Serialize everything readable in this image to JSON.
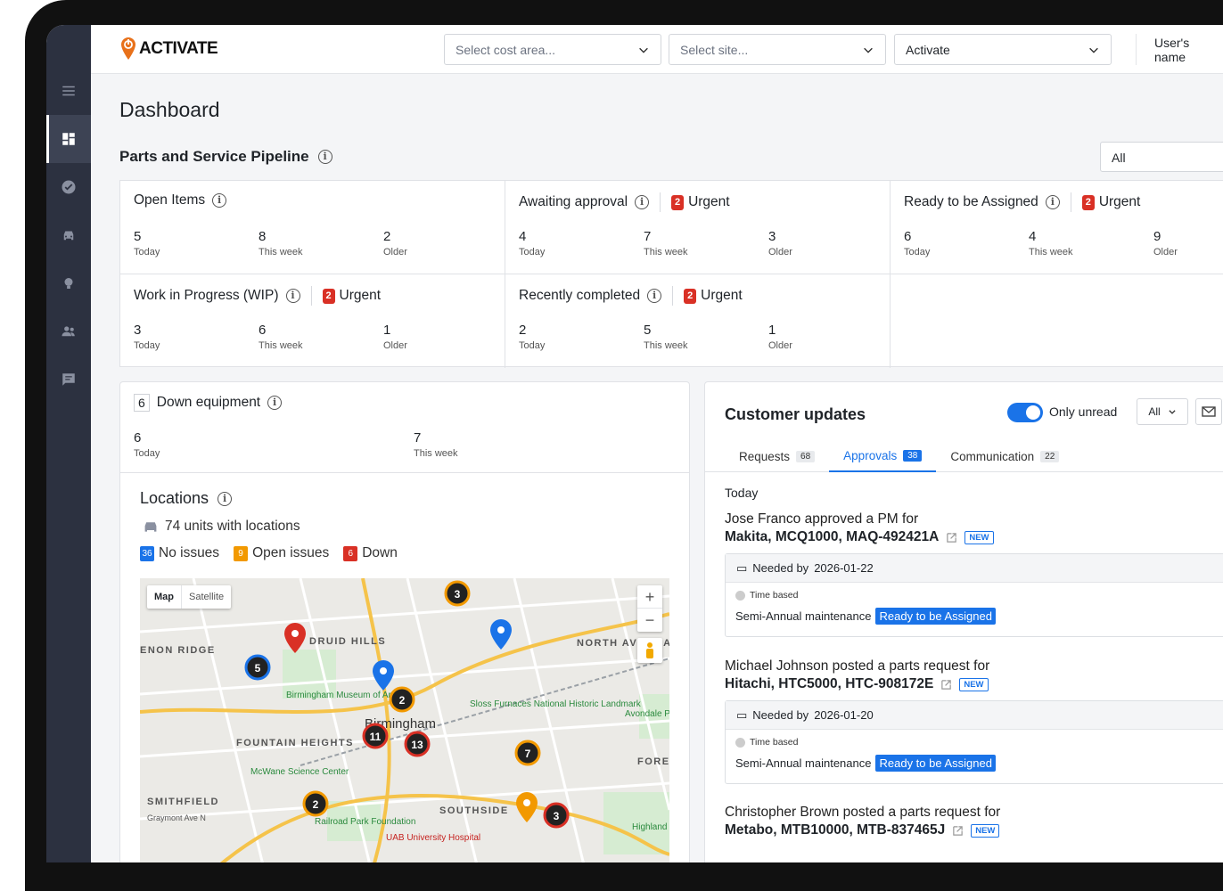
{
  "app": {
    "logo_text": "ACTIVATE"
  },
  "topbar": {
    "cost_area_placeholder": "Select cost area...",
    "site_placeholder": "Select site...",
    "org_value": "Activate",
    "user_name": "User's name"
  },
  "page": {
    "title": "Dashboard"
  },
  "pipeline": {
    "title": "Parts and Service Pipeline",
    "filter_value": "All",
    "urgent_label": "Urgent",
    "cells": [
      {
        "title": "Open Items",
        "urgent": null,
        "stats": [
          {
            "n": "5",
            "l": "Today"
          },
          {
            "n": "8",
            "l": "This week"
          },
          {
            "n": "2",
            "l": "Older"
          }
        ]
      },
      {
        "title": "Awaiting approval",
        "urgent": "2",
        "stats": [
          {
            "n": "4",
            "l": "Today"
          },
          {
            "n": "7",
            "l": "This week"
          },
          {
            "n": "3",
            "l": "Older"
          }
        ]
      },
      {
        "title": "Ready to be Assigned",
        "urgent": "2",
        "stats": [
          {
            "n": "6",
            "l": "Today"
          },
          {
            "n": "4",
            "l": "This week"
          },
          {
            "n": "9",
            "l": "Older"
          }
        ]
      },
      {
        "title": "Work in Progress (WIP)",
        "urgent": "2",
        "stats": [
          {
            "n": "3",
            "l": "Today"
          },
          {
            "n": "6",
            "l": "This week"
          },
          {
            "n": "1",
            "l": "Older"
          }
        ]
      },
      {
        "title": "Recently completed",
        "urgent": "2",
        "stats": [
          {
            "n": "2",
            "l": "Today"
          },
          {
            "n": "5",
            "l": "This week"
          },
          {
            "n": "1",
            "l": "Older"
          }
        ]
      }
    ]
  },
  "down_equipment": {
    "count": "6",
    "title": "Down equipment",
    "stats": [
      {
        "n": "6",
        "l": "Today"
      },
      {
        "n": "7",
        "l": "This week"
      }
    ]
  },
  "locations": {
    "title": "Locations",
    "units_text": "74 units with locations",
    "legend": [
      {
        "count": "36",
        "label": "No issues",
        "color": "#1a73e8"
      },
      {
        "count": "9",
        "label": "Open issues",
        "color": "#f29900"
      },
      {
        "count": "6",
        "label": "Down",
        "color": "#d93025"
      }
    ],
    "map": {
      "type_map": "Map",
      "type_satellite": "Satellite",
      "zoom_in": "+",
      "zoom_out": "−",
      "labels": [
        "DRUID HILLS",
        "NORTH AVONDALE",
        "ENON RIDGE",
        "Birmingham Museum of Art",
        "Birmingham",
        "Sloss Furnaces National Historic Landmark",
        "Avondale P",
        "FOUNTAIN HEIGHTS",
        "McWane Science Center",
        "FORE",
        "SMITHFIELD",
        "Graymont Ave N",
        "SOUTHSIDE",
        "UAB University Hospital",
        "Railroad Park Foundation",
        "Highland Golf Cou"
      ],
      "clusters": [
        "3",
        "5",
        "2",
        "11",
        "13",
        "7",
        "2",
        "3"
      ]
    }
  },
  "customer_updates": {
    "title": "Customer updates",
    "toggle_label": "Only unread",
    "filter_value": "All",
    "tabs": [
      {
        "label": "Requests",
        "count": "68"
      },
      {
        "label": "Approvals",
        "count": "38"
      },
      {
        "label": "Communication",
        "count": "22"
      }
    ],
    "day": "Today",
    "needed_prefix": "Needed by",
    "items": [
      {
        "who": "Jose Franco approved a PM for",
        "what": "Makita, MCQ1000, MAQ-492421A",
        "new": "NEW",
        "needed": "2026-01-22",
        "type": "Time based",
        "task": "Semi-Annual maintenance",
        "status": "Ready to be Assigned"
      },
      {
        "who": "Michael Johnson posted a parts request for",
        "what": "Hitachi, HTC5000, HTC-908172E",
        "new": "NEW",
        "needed": "2026-01-20",
        "type": "Time based",
        "task": "Semi-Annual maintenance",
        "status": "Ready to be Assigned"
      },
      {
        "who": "Christopher Brown posted a parts request for",
        "what": "Metabo, MTB10000, MTB-837465J",
        "new": "NEW"
      }
    ]
  }
}
